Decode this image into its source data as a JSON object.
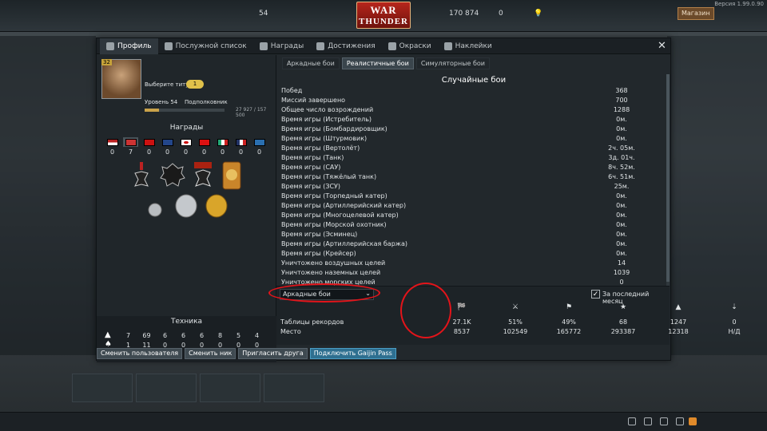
{
  "topbar": {
    "level": "54",
    "logo_line1": "WAR",
    "logo_line2": "THUNDER",
    "silver_lions": "170 874",
    "golden_eagles": "0",
    "shop_label": "Магазин",
    "version": "Версия 1.99.0.90"
  },
  "tabs": [
    {
      "label": "Профиль",
      "icon": "profile-icon"
    },
    {
      "label": "Послужной список",
      "icon": "list-icon"
    },
    {
      "label": "Награды",
      "icon": "cup-icon"
    },
    {
      "label": "Достижения",
      "icon": "star-icon"
    },
    {
      "label": "Окраски",
      "icon": "paint-icon"
    },
    {
      "label": "Наклейки",
      "icon": "sticker-icon"
    }
  ],
  "profile": {
    "avatar_level": "32",
    "title_label": "Выберите титул",
    "title_count": "1",
    "level_label": "Уровень 54",
    "rank_label": "Подполковник",
    "xp_text": "27 927 / 157 500",
    "xp_fraction": 0.18
  },
  "awards": {
    "header": "Награды",
    "counts": [
      "0",
      "7",
      "0",
      "0",
      "0",
      "0",
      "0",
      "0",
      "0"
    ]
  },
  "tech": {
    "header": "Техника",
    "row1": [
      "7",
      "69",
      "6",
      "6",
      "6",
      "8",
      "5",
      "4"
    ],
    "row2": [
      "1",
      "11",
      "0",
      "0",
      "0",
      "0",
      "0",
      "0"
    ]
  },
  "mode_tabs": [
    "Аркадные бои",
    "Реалистичные бои",
    "Симуляторные бои"
  ],
  "stats_title": "Случайные бои",
  "stats": [
    {
      "k": "Побед",
      "v": "368"
    },
    {
      "k": "Миссий завершено",
      "v": "700"
    },
    {
      "k": "Общее число возрождений",
      "v": "1288"
    },
    {
      "k": "Время игры (Истребитель)",
      "v": "0м."
    },
    {
      "k": "Время игры (Бомбардировщик)",
      "v": "0м."
    },
    {
      "k": "Время игры (Штурмовик)",
      "v": "0м."
    },
    {
      "k": "Время игры (Вертолёт)",
      "v": "2ч. 05м."
    },
    {
      "k": "Время игры (Танк)",
      "v": "3д. 01ч."
    },
    {
      "k": "Время игры (САУ)",
      "v": "8ч. 52м."
    },
    {
      "k": "Время игры (Тяжёлый танк)",
      "v": "6ч. 51м."
    },
    {
      "k": "Время игры (ЗСУ)",
      "v": "25м."
    },
    {
      "k": "Время игры (Торпедный катер)",
      "v": "0м."
    },
    {
      "k": "Время игры (Артиллерийский катер)",
      "v": "0м."
    },
    {
      "k": "Время игры (Многоцелевой катер)",
      "v": "0м."
    },
    {
      "k": "Время игры (Морской охотник)",
      "v": "0м."
    },
    {
      "k": "Время игры (Эсминец)",
      "v": "0м."
    },
    {
      "k": "Время игры (Артиллерийская баржа)",
      "v": "0м."
    },
    {
      "k": "Время игры (Крейсер)",
      "v": "0м."
    },
    {
      "k": "Уничтожено воздушных целей",
      "v": "14"
    },
    {
      "k": "Уничтожено наземных целей",
      "v": "1039"
    },
    {
      "k": "Уничтожено морских целей",
      "v": "0"
    }
  ],
  "leaderboard": {
    "mode_select": "Аркадные бои",
    "last_month_label": "За последний месяц",
    "row1_label": "Таблицы рекордов",
    "row1": [
      "27.1K",
      "51%",
      "49%",
      "68",
      "1247",
      "0"
    ],
    "row2_label": "Место",
    "row2": [
      "8537",
      "102549",
      "165772",
      "293387",
      "12318",
      "Н/Д"
    ]
  },
  "actions": [
    "Сменить пользователя",
    "Сменить ник",
    "Пригласить друга",
    "Подключить Gaijin Pass"
  ],
  "colors": {
    "accent": "#2e6f90",
    "annotation": "#e3141a"
  }
}
